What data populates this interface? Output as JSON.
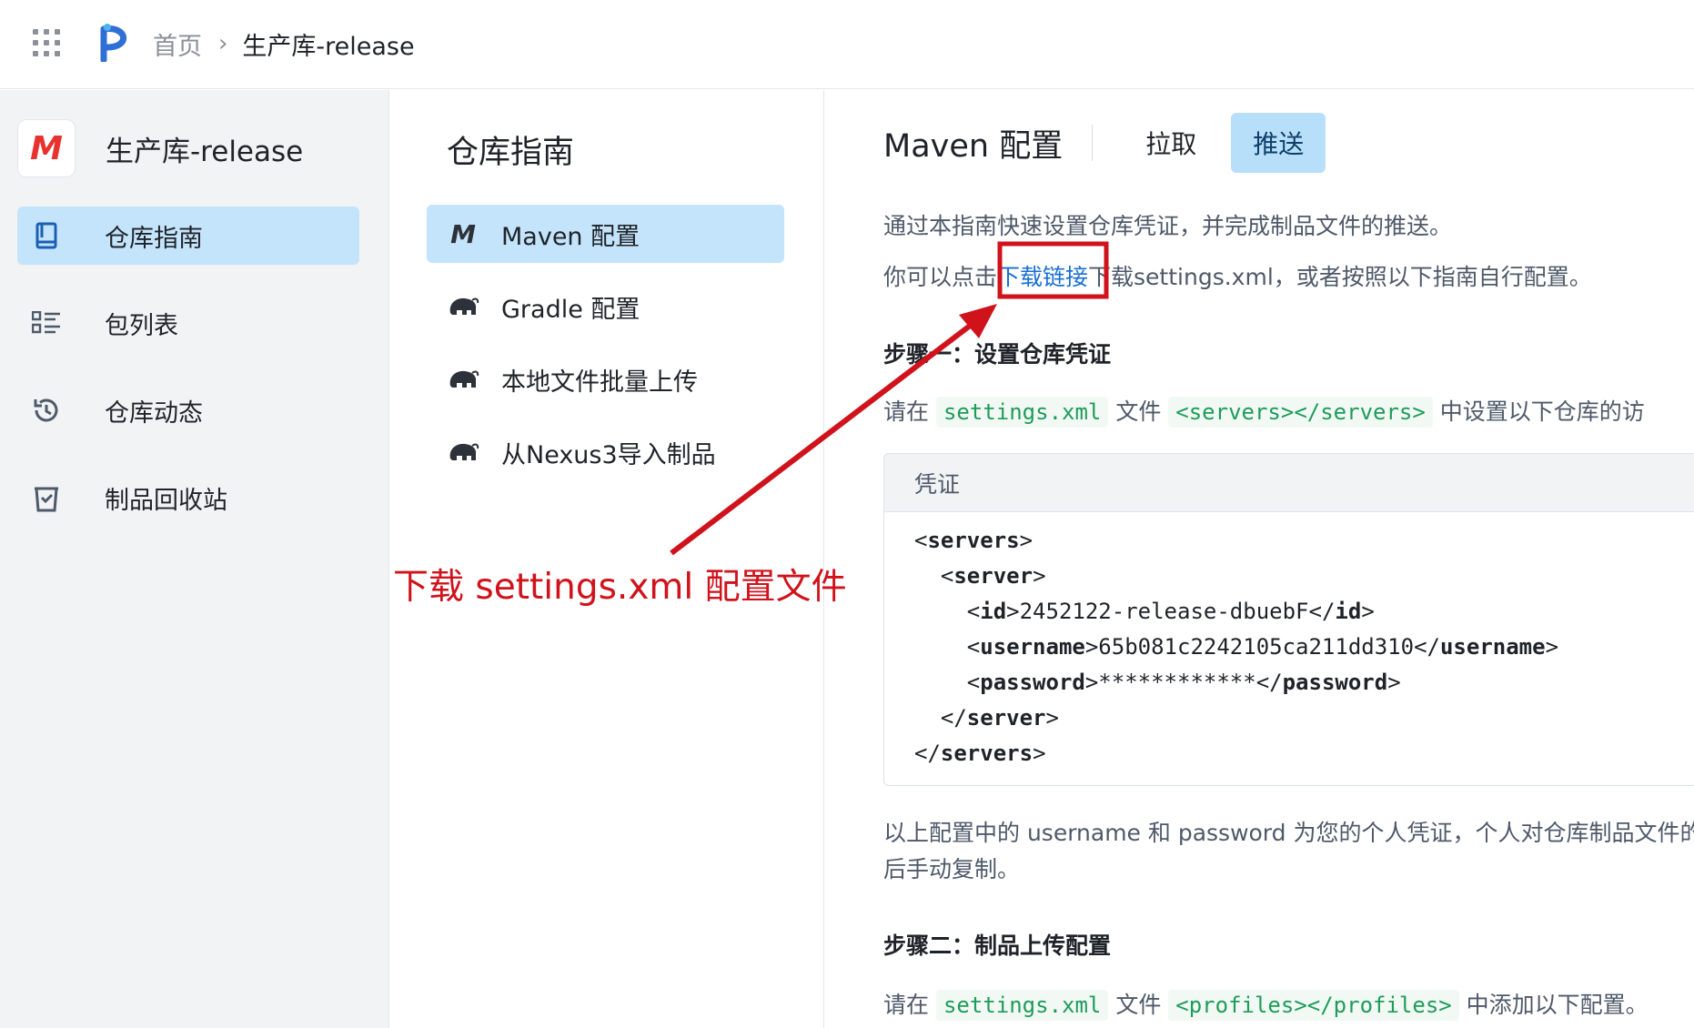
{
  "topbar": {
    "breadcrumb_home": "首页",
    "breadcrumb_current": "生产库-release"
  },
  "sidebar": {
    "repo_avatar_letter": "M",
    "repo_name": "生产库-release",
    "items": [
      {
        "label": "仓库指南",
        "icon": "book-icon",
        "active": true
      },
      {
        "label": "包列表",
        "icon": "list-icon",
        "active": false
      },
      {
        "label": "仓库动态",
        "icon": "history-icon",
        "active": false
      },
      {
        "label": "制品回收站",
        "icon": "recycle-bin-icon",
        "active": false
      }
    ]
  },
  "guide": {
    "title": "仓库指南",
    "items": [
      {
        "label": "Maven 配置",
        "icon": "maven-icon",
        "icon_text": "M",
        "active": true
      },
      {
        "label": "Gradle 配置",
        "icon": "gradle-elephant-icon",
        "active": false
      },
      {
        "label": "本地文件批量上传",
        "icon": "gradle-elephant-icon",
        "active": false
      },
      {
        "label": "从Nexus3导入制品",
        "icon": "gradle-elephant-icon",
        "active": false
      }
    ]
  },
  "content": {
    "title": "Maven 配置",
    "tabs": [
      {
        "label": "拉取",
        "active": false
      },
      {
        "label": "推送",
        "active": true
      }
    ],
    "intro_1": "通过本指南快速设置仓库凭证，并完成制品文件的推送。",
    "intro_2_before": "你可以点击",
    "intro_2_link": "下载链接",
    "intro_2_after": "下载settings.xml，或者按照以下指南自行配置。",
    "step1_title": "步骤一：设置仓库凭证",
    "step1_text_a": "请在",
    "step1_code_a": "settings.xml",
    "step1_text_b": "文件",
    "step1_code_b": "<servers></servers>",
    "step1_text_c": "中设置以下仓库的访",
    "code_box_title": "凭证",
    "code_lines": {
      "l1_open": "<",
      "l1_tag": "servers",
      "l1_close": ">",
      "l2_open": "<",
      "l2_tag": "server",
      "l2_close": ">",
      "l3_tag": "id",
      "l3_value": "2452122-release-dbuebF",
      "l4_tag": "username",
      "l4_value": "65b081c2242105ca211dd310",
      "l5_tag": "password",
      "l5_value": "************",
      "l6_tag": "server",
      "l7_tag": "servers"
    },
    "note_line1": "以上配置中的 username 和 password 为您的个人凭证，个人对仓库制品文件的",
    "note_line2": "后手动复制。",
    "step2_title": "步骤二：制品上传配置",
    "step2_text_a": "请在",
    "step2_code_a": "settings.xml",
    "step2_text_b": "文件",
    "step2_code_b": "<profiles></profiles>",
    "step2_text_c": "中添加以下配置。"
  },
  "annotation": {
    "label": "下载 settings.xml 配置文件",
    "color": "#d0121b"
  },
  "colors": {
    "accent": "#1a6fd4",
    "active_bg": "#c4e4fb",
    "code_green": "#1e9c59"
  }
}
